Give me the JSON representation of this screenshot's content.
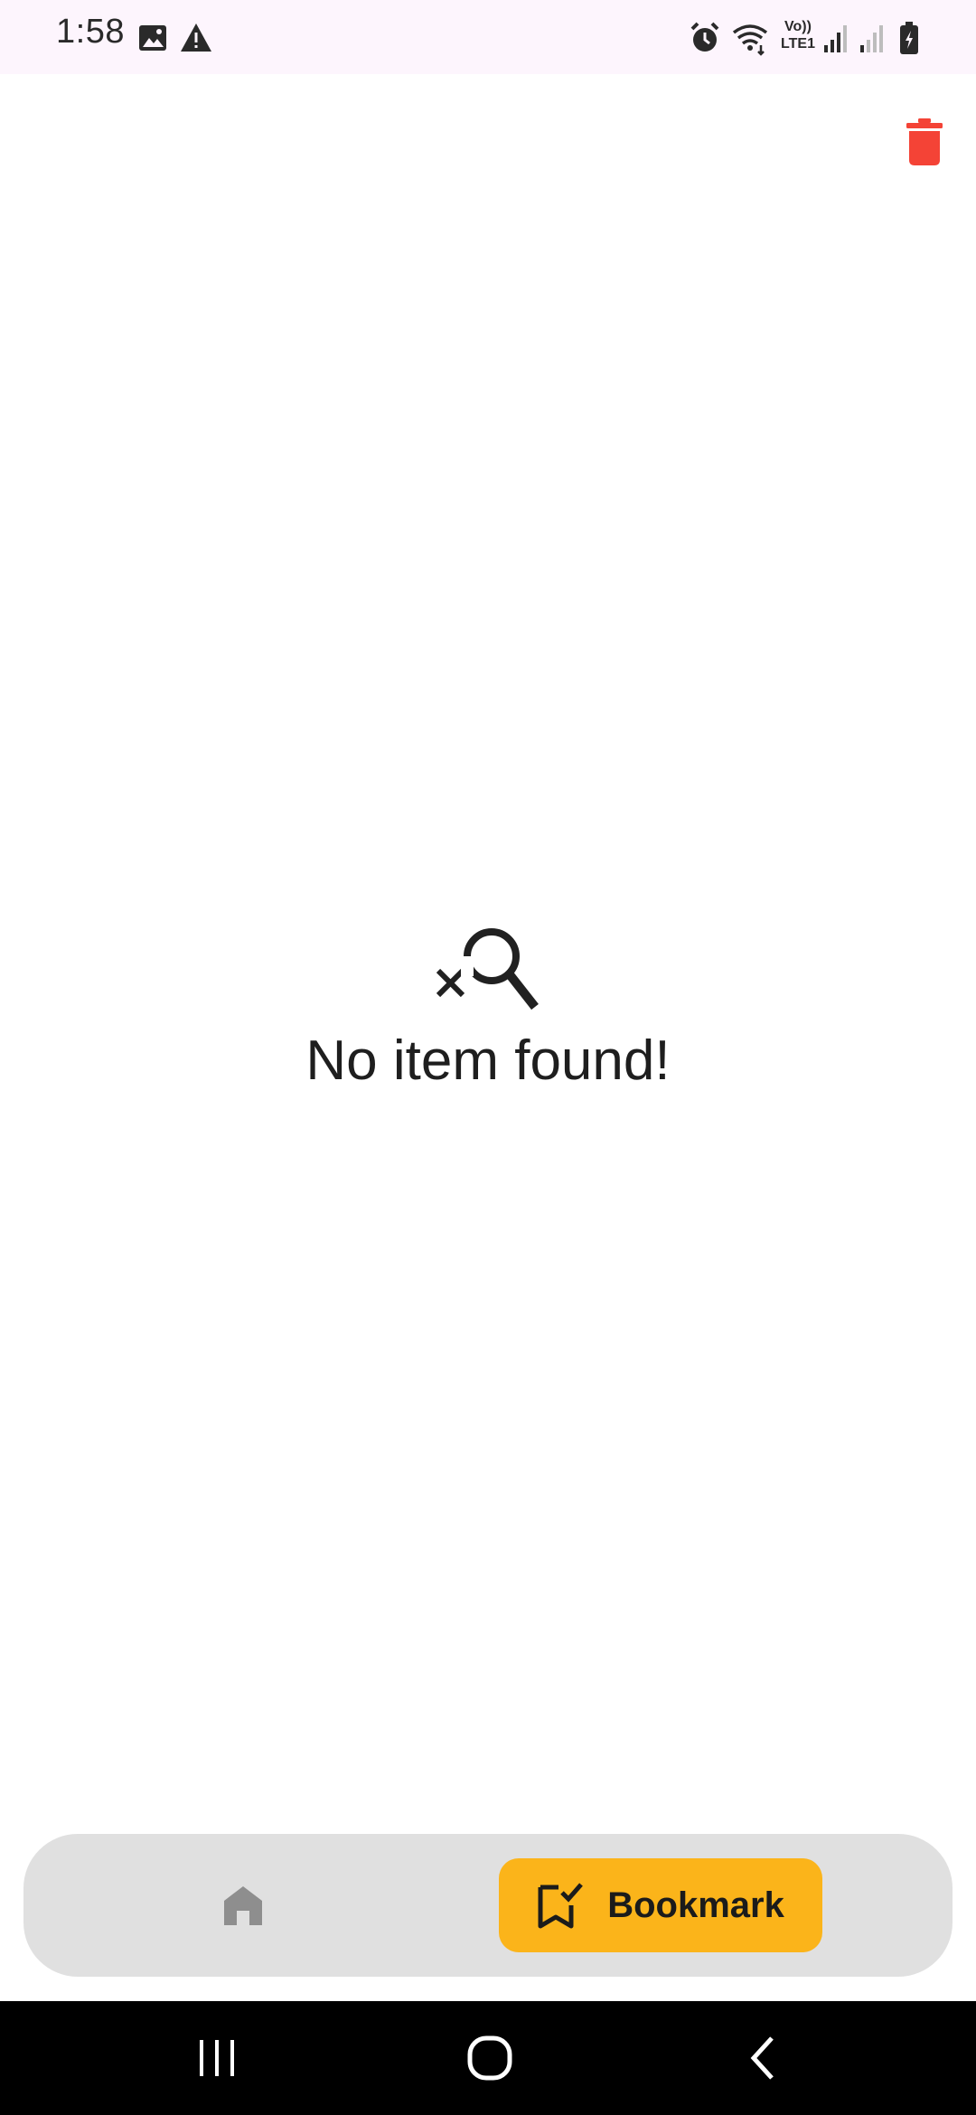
{
  "status_bar": {
    "time": "1:58",
    "lte_label_top": "Vo))",
    "lte_label_bottom": "LTE1",
    "icons": [
      "gallery-icon",
      "warning-icon",
      "alarm-icon",
      "wifi-icon",
      "volte-lte-icon",
      "signal-icon",
      "signal-weak-icon",
      "battery-charging-icon"
    ]
  },
  "top_actions": {
    "delete_icon": "trash-icon",
    "delete_color": "#f44336"
  },
  "empty_state": {
    "icon": "search-off-icon",
    "message": "No item found!"
  },
  "bottom_nav": {
    "items": [
      {
        "icon": "home-icon",
        "label": "",
        "selected": false
      },
      {
        "icon": "bookmark-check-icon",
        "label": "Bookmark",
        "selected": true
      }
    ],
    "active_color": "#fbb41a",
    "background": "#e0e0e0"
  },
  "system_nav": {
    "buttons": [
      "recent-apps-icon",
      "home-circle-icon",
      "back-icon"
    ]
  }
}
